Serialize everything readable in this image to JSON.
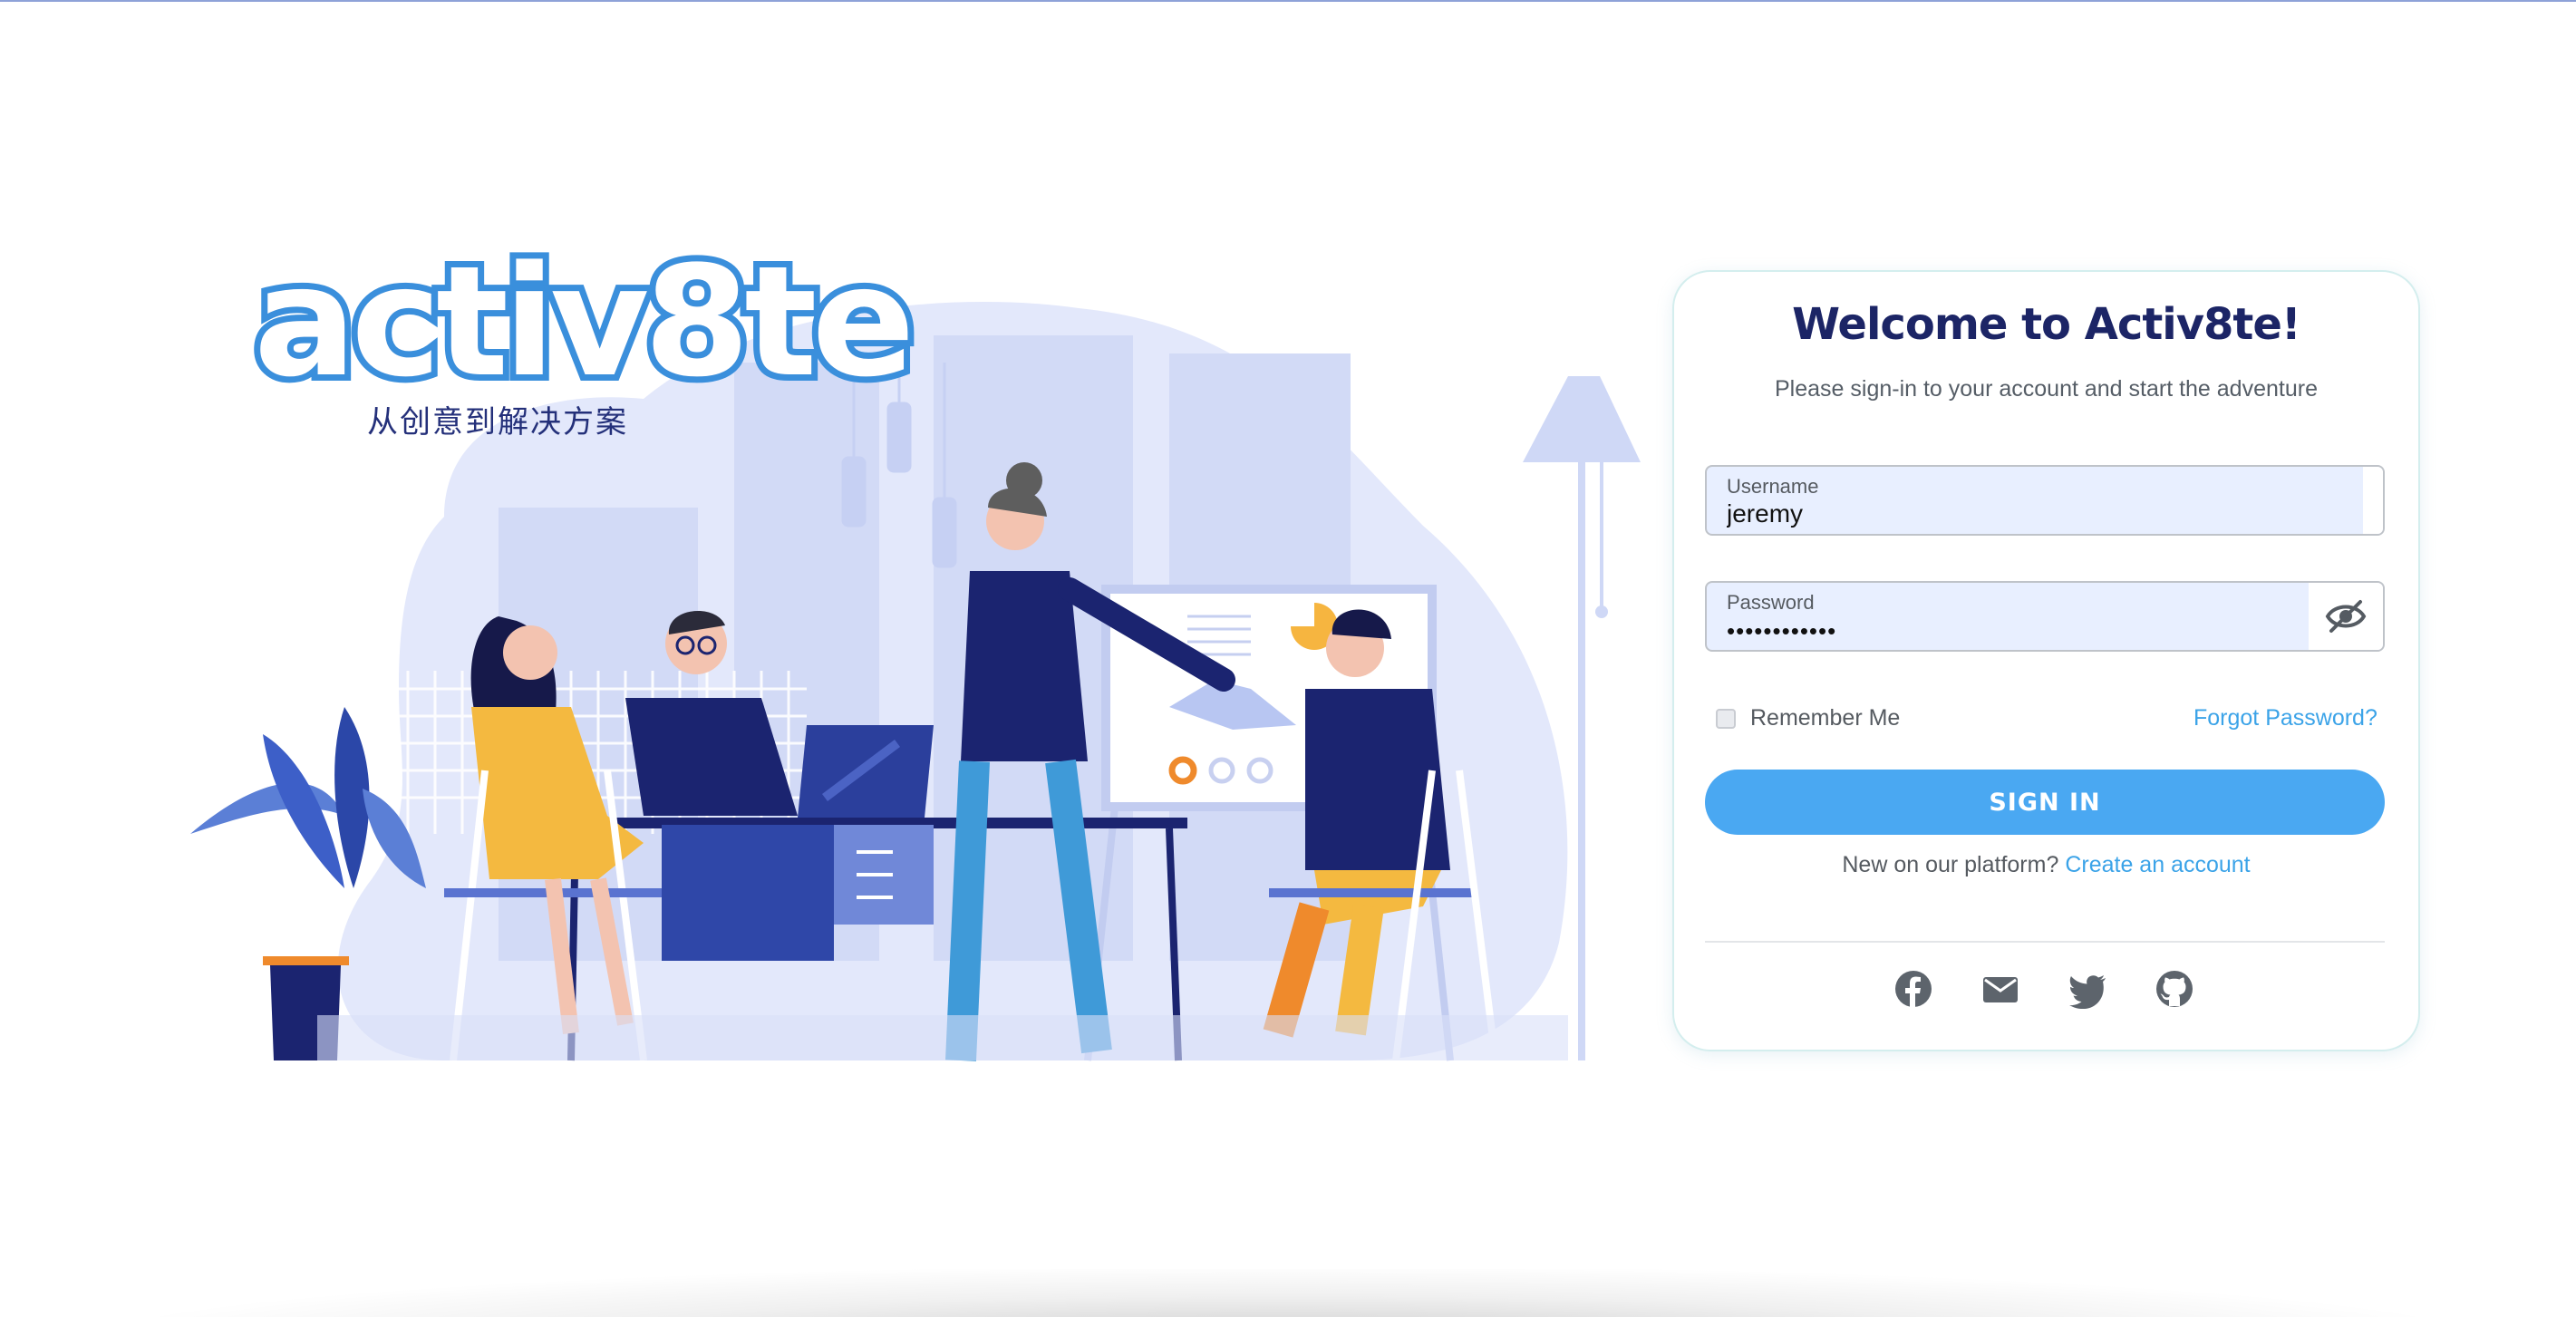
{
  "brand": {
    "logo_text": "activ8te",
    "tagline": "从创意到解决方案"
  },
  "login": {
    "title": "Welcome to Activ8te!",
    "subtitle": "Please sign-in to your account and start the adventure",
    "username": {
      "label": "Username",
      "value": "jeremy"
    },
    "password": {
      "label": "Password",
      "value": "••••••••••••",
      "toggle_icon": "eye-off-icon"
    },
    "remember_label": "Remember Me",
    "remember_checked": false,
    "forgot_label": "Forgot Password?",
    "signin_label": "SIGN IN",
    "new_prompt": "New on our platform?",
    "create_account_label": "Create an account",
    "social_icons": [
      "facebook-icon",
      "email-icon",
      "twitter-icon",
      "github-icon"
    ]
  },
  "colors": {
    "accent": "#4aa8f2",
    "link": "#3ba3e8",
    "title": "#1c2566",
    "input_bg": "#e8efff"
  }
}
